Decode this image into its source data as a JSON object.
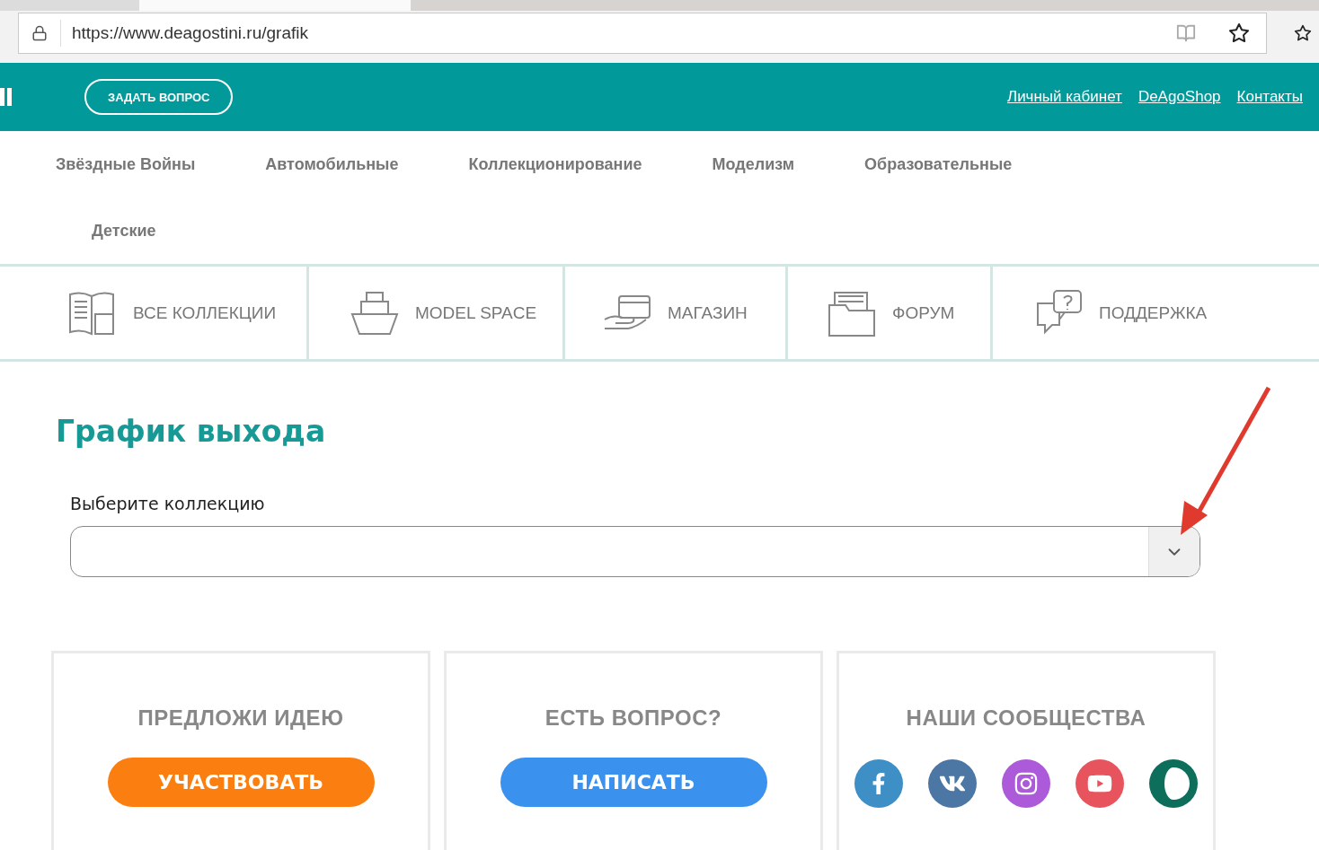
{
  "browser": {
    "url": "https://www.deagostini.ru/grafik"
  },
  "header": {
    "ask_button": "ЗАДАТЬ ВОПРОС",
    "links": [
      "Личный кабинет",
      "DeAgoShop",
      "Контакты"
    ]
  },
  "categories": [
    "Звёздные Войны",
    "Автомобильные",
    "Коллекционирование",
    "Моделизм",
    "Образовательные",
    "Детские"
  ],
  "nav_tiles": [
    {
      "kind": "collections",
      "label": "ВСЕ КОЛЛЕКЦИИ"
    },
    {
      "kind": "ship",
      "label": "MODEL SPACE"
    },
    {
      "kind": "shop",
      "label": "МАГАЗИН"
    },
    {
      "kind": "forum",
      "label": "ФОРУМ"
    },
    {
      "kind": "support",
      "label": "ПОДДЕРЖКА"
    }
  ],
  "page_title": "График выхода",
  "select_label": "Выберите коллекцию",
  "cards": [
    {
      "kind": "button",
      "title": "ПРЕДЛОЖИ ИДЕЮ",
      "button": "УЧАСТВОВАТЬ",
      "color": "#fb7f10"
    },
    {
      "kind": "button",
      "title": "ЕСТЬ ВОПРОС?",
      "button": "НАПИСАТЬ",
      "color": "#3a91ee"
    },
    {
      "kind": "social",
      "title": "НАШИ СООБЩЕСТВА",
      "socials": [
        {
          "kind": "facebook",
          "color": "#3d8fc6"
        },
        {
          "kind": "vk",
          "color": "#4c76a4"
        },
        {
          "kind": "instagram",
          "color": "#ac5ad9"
        },
        {
          "kind": "youtube",
          "color": "#e7545e"
        },
        {
          "kind": "fan",
          "color": "#0d6e5c"
        }
      ]
    }
  ]
}
